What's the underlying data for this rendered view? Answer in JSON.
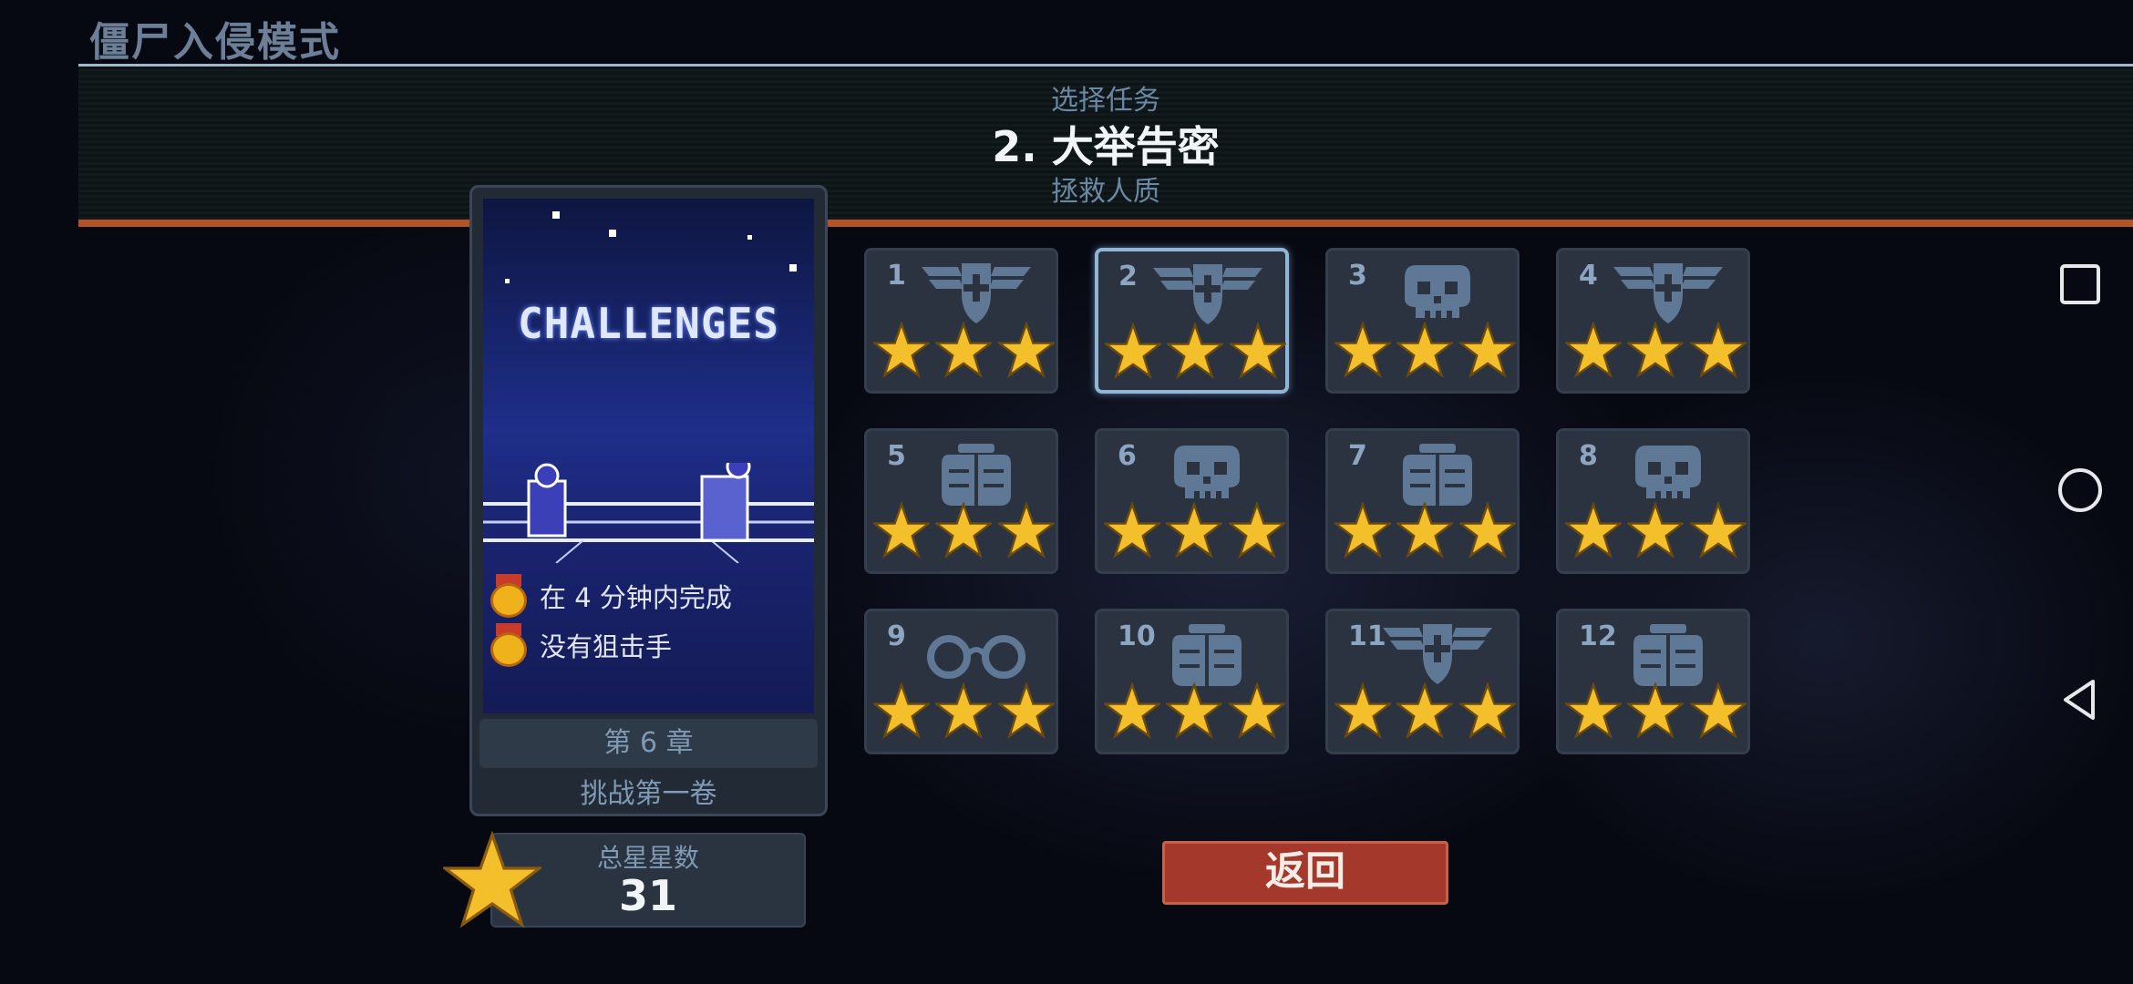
{
  "mode_title": "僵尸入侵模式",
  "header": {
    "subtitle": "选择任务",
    "mission_title": "2. 大举告密",
    "objective": "拯救人质"
  },
  "card": {
    "art_title": "CHALLENGES",
    "challenges": [
      "在 4 分钟内完成",
      "没有狙击手"
    ],
    "chapter": "第 6 章",
    "volume": "挑战第一卷"
  },
  "total_stars": {
    "label": "总星星数",
    "value": "31"
  },
  "levels": [
    {
      "num": "1",
      "emblem": "winged-shield-icon",
      "stars": 3
    },
    {
      "num": "2",
      "emblem": "winged-shield-icon",
      "stars": 3,
      "selected": true
    },
    {
      "num": "3",
      "emblem": "skull-icon",
      "stars": 3
    },
    {
      "num": "4",
      "emblem": "winged-shield-icon",
      "stars": 3
    },
    {
      "num": "5",
      "emblem": "armor-vest-icon",
      "stars": 3
    },
    {
      "num": "6",
      "emblem": "skull-icon",
      "stars": 3
    },
    {
      "num": "7",
      "emblem": "armor-vest-icon",
      "stars": 3
    },
    {
      "num": "8",
      "emblem": "skull-icon",
      "stars": 3
    },
    {
      "num": "9",
      "emblem": "handcuffs-icon",
      "stars": 3
    },
    {
      "num": "10",
      "emblem": "armor-vest-icon",
      "stars": 3
    },
    {
      "num": "11",
      "emblem": "winged-shield-icon",
      "stars": 3
    },
    {
      "num": "12",
      "emblem": "armor-vest-icon",
      "stars": 3
    }
  ],
  "back_button": "返回",
  "system_nav": [
    "recent-apps-icon",
    "home-icon",
    "back-icon"
  ],
  "colors": {
    "star_gold": "#f3bf2a",
    "emblem": "#5f7896",
    "back_button": "#a4392b",
    "header_accent": "#b4532a"
  }
}
